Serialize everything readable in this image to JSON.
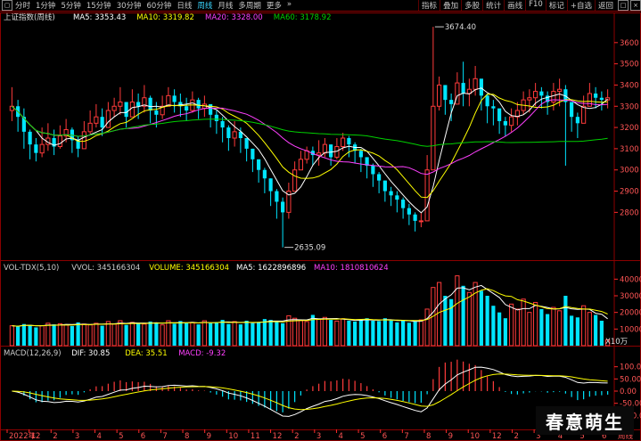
{
  "toolbar": {
    "tabs": [
      "分时",
      "1分钟",
      "5分钟",
      "15分钟",
      "30分钟",
      "60分钟",
      "日线",
      "周线",
      "月线",
      "多周期",
      "更多"
    ],
    "active_tab": "周线",
    "more_arrow": "»",
    "right_tabs": [
      "指标",
      "叠加",
      "多股",
      "统计",
      "画线",
      "F10",
      "标记",
      "+自选",
      "返回"
    ]
  },
  "colors": {
    "up": "#ff3b3b",
    "down": "#00e5ff",
    "ma5": "#ffffff",
    "ma10": "#ffff00",
    "ma20": "#ff40ff",
    "ma60": "#00d000",
    "grid": "#8b0000",
    "axis": "#ff2a2a"
  },
  "chart_data": [
    {
      "type": "candlestick",
      "panel": "price",
      "title": "上证指数(周线)",
      "legend": [
        {
          "name": "MA5",
          "value": "3353.43",
          "color": "#ffffff"
        },
        {
          "name": "MA10",
          "value": "3319.82",
          "color": "#ffff00"
        },
        {
          "name": "MA20",
          "value": "3328.00",
          "color": "#ff40ff"
        },
        {
          "name": "MA60",
          "value": "3178.92",
          "color": "#00d000"
        }
      ],
      "ylim": [
        2600,
        3700
      ],
      "yticks": [
        "3600",
        "3500",
        "3400",
        "3300",
        "3200",
        "3100",
        "3000",
        "2900",
        "2800"
      ],
      "annotations": [
        {
          "label": "3674.40"
        },
        {
          "label": "2635.09"
        }
      ],
      "closes": [
        3300,
        3250,
        3180,
        3120,
        3080,
        3120,
        3150,
        3110,
        3160,
        3190,
        3140,
        3100,
        3180,
        3220,
        3250,
        3200,
        3280,
        3300,
        3320,
        3250,
        3320,
        3300,
        3340,
        3280,
        3260,
        3300,
        3350,
        3320,
        3300,
        3280,
        3330,
        3290,
        3310,
        3260,
        3230,
        3200,
        3150,
        3180,
        3150,
        3100,
        3050,
        3000,
        2960,
        2900,
        2850,
        2800,
        2900,
        3000,
        3050,
        3090,
        3070,
        3080,
        3120,
        3060,
        3110,
        3150,
        3120,
        3090,
        3060,
        3020,
        2980,
        2950,
        2900,
        2880,
        2860,
        2820,
        2790,
        2760,
        2760,
        3000,
        3300,
        3400,
        3330,
        3310,
        3410,
        3360,
        3380,
        3430,
        3350,
        3300,
        3290,
        3230,
        3210,
        3250,
        3280,
        3330,
        3340,
        3370,
        3350,
        3320,
        3370,
        3380,
        3320,
        3250,
        3220,
        3300,
        3360,
        3340,
        3330,
        3340
      ],
      "highs": [
        3390,
        3330,
        3290,
        3190,
        3150,
        3200,
        3220,
        3190,
        3210,
        3240,
        3200,
        3160,
        3230,
        3280,
        3310,
        3290,
        3320,
        3340,
        3390,
        3320,
        3380,
        3360,
        3400,
        3350,
        3320,
        3350,
        3390,
        3380,
        3360,
        3340,
        3370,
        3340,
        3350,
        3300,
        3280,
        3250,
        3210,
        3230,
        3200,
        3150,
        3100,
        3050,
        3010,
        2960,
        2910,
        2870,
        2940,
        3040,
        3090,
        3110,
        3110,
        3140,
        3150,
        3120,
        3150,
        3175,
        3160,
        3130,
        3100,
        3060,
        3030,
        2990,
        2950,
        2920,
        2900,
        2870,
        2840,
        2800,
        2800,
        3070,
        3674.4,
        3440,
        3390,
        3360,
        3460,
        3510,
        3430,
        3490,
        3410,
        3360,
        3330,
        3280,
        3250,
        3290,
        3320,
        3370,
        3380,
        3410,
        3390,
        3370,
        3410,
        3430,
        3400,
        3300,
        3270,
        3350,
        3410,
        3390,
        3370,
        3380
      ],
      "lows": [
        3230,
        3180,
        3100,
        3050,
        3040,
        3060,
        3090,
        3070,
        3100,
        3130,
        3080,
        3060,
        3110,
        3170,
        3200,
        3160,
        3230,
        3250,
        3260,
        3200,
        3250,
        3240,
        3270,
        3220,
        3200,
        3240,
        3300,
        3270,
        3250,
        3230,
        3270,
        3240,
        3250,
        3200,
        3170,
        3130,
        3090,
        3110,
        3080,
        3040,
        2990,
        2940,
        2890,
        2830,
        2770,
        2635.09,
        2770,
        2910,
        3000,
        3030,
        3020,
        3020,
        3060,
        3020,
        3050,
        3090,
        3060,
        3030,
        2990,
        2960,
        2920,
        2890,
        2850,
        2830,
        2800,
        2770,
        2740,
        2710,
        2730,
        2880,
        3180,
        3280,
        3260,
        3230,
        3330,
        3300,
        3300,
        3350,
        3280,
        3220,
        3210,
        3170,
        3160,
        3180,
        3210,
        3260,
        3270,
        3300,
        3290,
        3260,
        3280,
        3300,
        3020,
        3180,
        3150,
        3230,
        3300,
        3290,
        3280,
        3290
      ]
    },
    {
      "type": "bar",
      "panel": "volume",
      "legend": [
        {
          "name": "VOL-TDX(5,10)",
          "value": "",
          "color": "#cccccc"
        },
        {
          "name": "VVOL:",
          "value": "345166304",
          "color": "#cccccc"
        },
        {
          "name": "VOLUME:",
          "value": "345166304",
          "color": "#ffff00"
        },
        {
          "name": "MA5:",
          "value": "1622896896",
          "color": "#ffffff"
        },
        {
          "name": "MA10:",
          "value": "1810810624",
          "color": "#ff40ff"
        }
      ],
      "ylim": [
        0,
        45000
      ],
      "yticks": [
        "40000",
        "30000",
        "20000",
        "10000"
      ],
      "unit_label": "X10万",
      "values": [
        12000,
        11500,
        13000,
        12500,
        11000,
        12000,
        13500,
        12800,
        13200,
        12500,
        11800,
        14000,
        13000,
        12500,
        13500,
        12000,
        14500,
        13000,
        15000,
        12500,
        14000,
        13500,
        13000,
        14500,
        13800,
        12500,
        15000,
        13200,
        14800,
        13500,
        14000,
        12800,
        15000,
        13500,
        14200,
        15500,
        13000,
        14500,
        12800,
        15000,
        13500,
        14000,
        16000,
        15500,
        14800,
        13500,
        18000,
        16500,
        15000,
        14500,
        18500,
        16000,
        17000,
        15500,
        14800,
        16200,
        15000,
        14500,
        15800,
        16500,
        15000,
        14800,
        16500,
        15200,
        14000,
        15500,
        13800,
        14500,
        15500,
        22000,
        35000,
        38000,
        30000,
        28000,
        42000,
        36000,
        32000,
        38000,
        33000,
        30000,
        24000,
        20000,
        16500,
        25000,
        22000,
        28000,
        20000,
        26000,
        22000,
        19000,
        23000,
        21000,
        30000,
        18000,
        17000,
        24000,
        20000,
        18500,
        15000,
        3500
      ]
    },
    {
      "type": "line",
      "panel": "macd",
      "legend": [
        {
          "name": "MACD(12,26,9)",
          "value": "",
          "color": "#cccccc"
        },
        {
          "name": "DIF:",
          "value": "30.85",
          "color": "#ffffff"
        },
        {
          "name": "DEA:",
          "value": "35.51",
          "color": "#ffff00"
        },
        {
          "name": "MACD:",
          "value": "-9.32",
          "color": "#ff40ff"
        }
      ],
      "ylim": [
        -150,
        150
      ],
      "yticks": [
        "100.00",
        "50.00",
        "0.00",
        "-50.00",
        "-100.00"
      ]
    }
  ],
  "x_axis": {
    "labels": [
      "2022年",
      "12",
      "2",
      "3",
      "4",
      "5",
      "6",
      "7",
      "8",
      "9",
      "10",
      "11",
      "12",
      "2",
      "3",
      "4",
      "5",
      "6",
      "7",
      "8",
      "9",
      "10",
      "12",
      "2",
      "3",
      "4",
      "5",
      "6"
    ],
    "right_label": "周线"
  },
  "watermark": "春意萌生"
}
